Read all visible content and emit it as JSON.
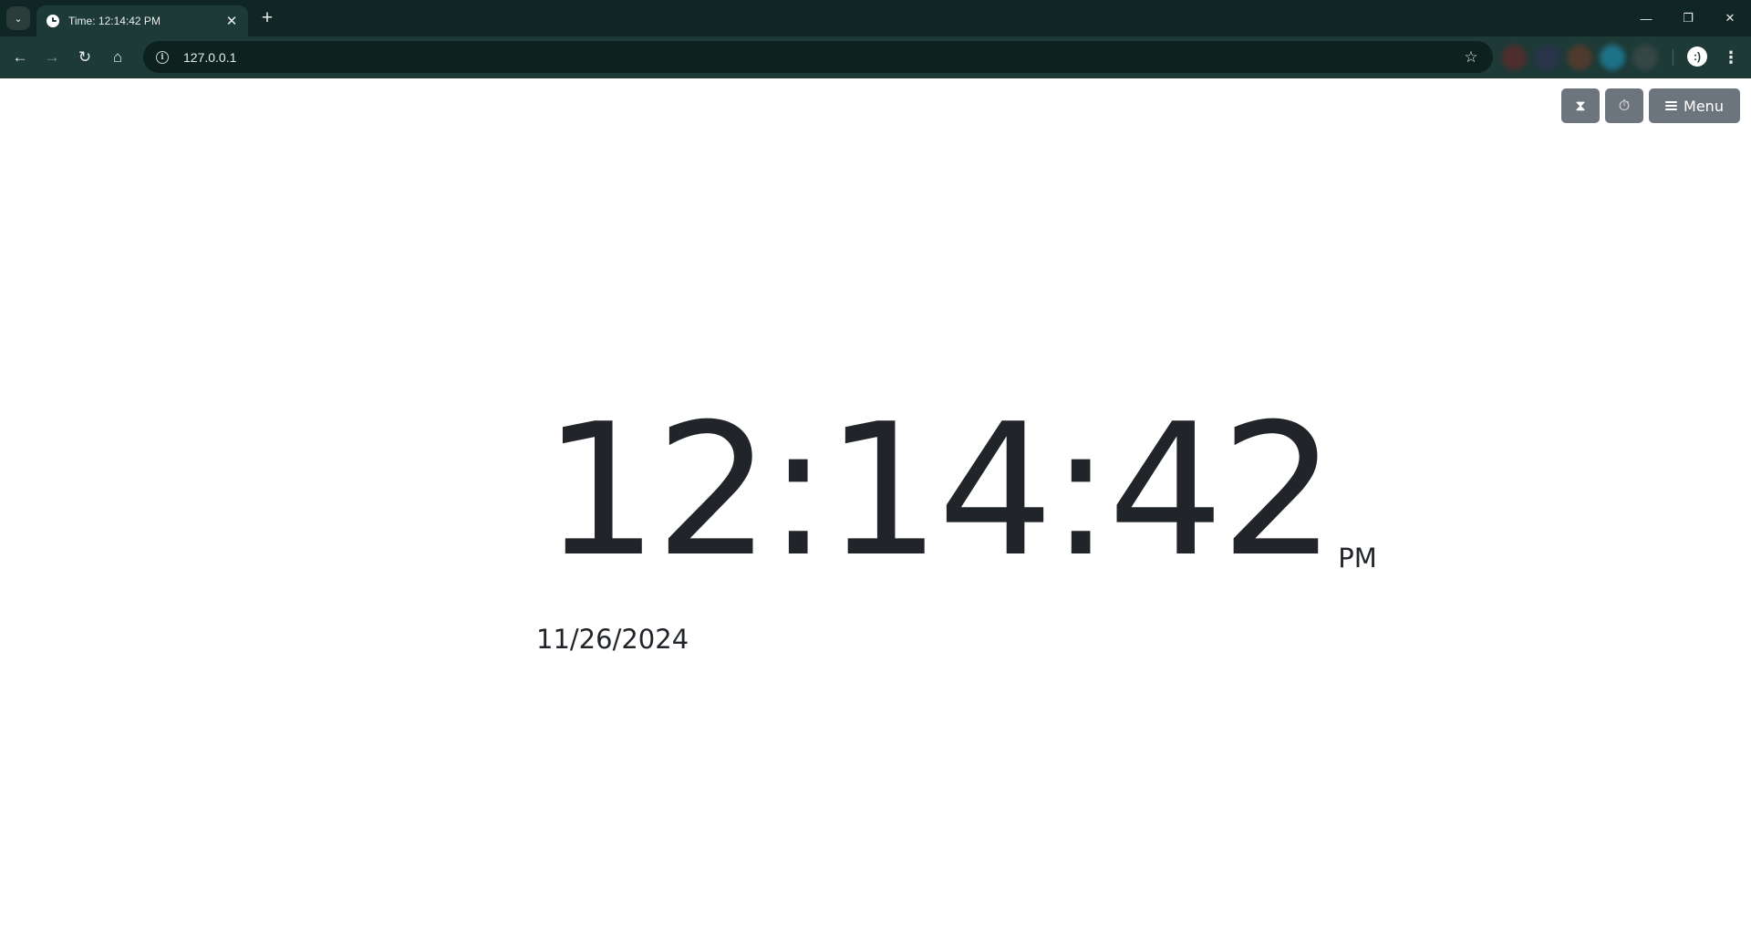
{
  "browser": {
    "tab": {
      "title": "Time: 12:14:42 PM",
      "favicon": "clock-icon"
    },
    "address": {
      "url": "127.0.0.1"
    },
    "icons": {
      "tab_search": "chevron-down-icon",
      "tab_close": "close-icon",
      "new_tab": "plus-icon",
      "back": "arrow-left-icon",
      "forward": "arrow-right-icon",
      "reload": "reload-icon",
      "home": "home-icon",
      "site_info": "info-icon",
      "bookmark": "star-icon",
      "profile": "profile-icon",
      "menu": "kebab-icon",
      "minimize": "minimize-icon",
      "restore": "restore-icon",
      "close": "close-icon"
    },
    "glyphs": {
      "tab_search": "⌄",
      "tab_close": "✕",
      "new_tab": "+",
      "back": "←",
      "forward": "→",
      "reload": "↻",
      "home": "⌂",
      "site_info": "i",
      "bookmark": "☆",
      "profile": ":)",
      "menu": "⋮",
      "minimize": "—",
      "restore": "❐",
      "close": "✕"
    },
    "extension_colors": [
      "#5a2b2b",
      "#2c3350",
      "#5c3a2c",
      "#1e7f9a",
      "#3c4a48"
    ]
  },
  "app": {
    "buttons": {
      "timer_glyph": "⧗",
      "stopwatch_glyph": "⏱",
      "menu_label": "Menu"
    },
    "icons": {
      "timer": "hourglass-icon",
      "stopwatch": "stopwatch-icon",
      "menu": "hamburger-icon"
    },
    "clock": {
      "time": "12:14:42",
      "ampm": "PM",
      "date": "11/26/2024"
    },
    "colors": {
      "button_bg": "#6c757d",
      "text": "#212529",
      "chrome_dark": "#0f2624",
      "chrome_toolbar": "#1d3a37"
    }
  }
}
